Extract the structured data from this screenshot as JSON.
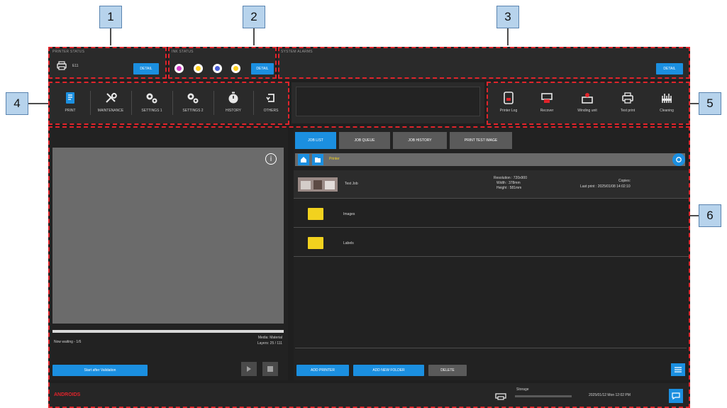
{
  "callouts": [
    "1",
    "2",
    "3",
    "4",
    "5",
    "6"
  ],
  "colors": {
    "background": "#1f1f1f",
    "panel": "#2a2a2a",
    "accent_blue": "#1b8fe0",
    "highlight_red": "#e0242b",
    "folder_yellow": "#f2d21e",
    "callout_fill": "#b7d3ec"
  },
  "printer_panel": {
    "title": "PRINTER STATUS",
    "printer_name": "E11",
    "button": "DETAIL",
    "icon": "printer-icon"
  },
  "ink_panel": {
    "title": "INK STATUS",
    "inks": [
      {
        "name": "magenta",
        "color": "#d23cc8"
      },
      {
        "name": "yellow",
        "color": "#ffd21e"
      },
      {
        "name": "blue",
        "color": "#4a5fd8"
      },
      {
        "name": "yellow",
        "color": "#ffd21e"
      }
    ],
    "button": "DETAIL"
  },
  "message_panel": {
    "title": "SYSTEM ALARMS",
    "button": "DETAIL"
  },
  "tools": [
    {
      "label": "PRINT",
      "icon": "print-job-icon"
    },
    {
      "label": "MAINTENANCE",
      "icon": "wrench-icon"
    },
    {
      "label": "SETTINGS 1",
      "icon": "gears-icon"
    },
    {
      "label": "SETTINGS 2",
      "icon": "gears-icon"
    },
    {
      "label": "HISTORY",
      "icon": "stopwatch-icon"
    },
    {
      "label": "OTHERS",
      "icon": "rotate-icon"
    }
  ],
  "maintenance": [
    {
      "label": "Printer Log",
      "icon": "printer-log-icon"
    },
    {
      "label": "Recover",
      "icon": "recover-icon"
    },
    {
      "label": "Winding unit",
      "icon": "winding-unit-icon"
    },
    {
      "label": "Test print",
      "icon": "test-print-icon"
    },
    {
      "label": "Cleaning",
      "icon": "cleaning-icon"
    }
  ],
  "preview": {
    "status": "Now waiting - 1/6",
    "info_line1": "Media: Material",
    "info_line2": "Layers: 25 / 111",
    "print_button": "Start after Validation",
    "play_icon": "play-icon",
    "stop_icon": "stop-icon",
    "info_icon": "info-icon"
  },
  "files": {
    "tabs": [
      {
        "label": "JOB LIST",
        "active": true
      },
      {
        "label": "JOB QUEUE",
        "active": false
      },
      {
        "label": "JOB HISTORY",
        "active": false
      },
      {
        "label": "PRINT TEST IMAGE",
        "active": false
      }
    ],
    "path": "Printer",
    "job": {
      "name": "Test Job",
      "detail_line1": "Resolution : 720x900",
      "detail_line2": "Width : 378mm",
      "detail_line3": "Height : 581mm",
      "meta_line1": "Copies:",
      "meta_line2": "Last print : 2025/01/08 14:02:10"
    },
    "folders": [
      {
        "name": "Images"
      },
      {
        "name": "Labels"
      }
    ],
    "buttons": {
      "add_file": "ADD PRINTER",
      "add_folder": "ADD NEW FOLDER",
      "delete": "DELETE"
    }
  },
  "statusbar": {
    "brand": "ANDROIDS",
    "storage_label": "Storage",
    "datetime": "2025/01/12 Mon 12:02 PM"
  }
}
